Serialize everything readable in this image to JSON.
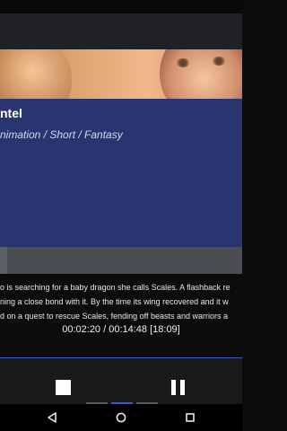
{
  "movie": {
    "title": "ntel",
    "genres": "nimation / Short / Fantasy",
    "description_lines": [
      "o is searching for a baby dragon she calls Scales. A flashback re",
      "ning a close bond with it. By the time its wing recovered and it w",
      "d on a quest to rescue Scales, fending off beasts and warriors a"
    ]
  },
  "player": {
    "time_readout": "00:02:20 / 00:14:48 [18:09]",
    "stop_icon": "stop-icon",
    "pause_icon": "pause-icon",
    "pages": 3,
    "active_page": 2
  },
  "navigation": {
    "back_icon": "back-triangle-icon",
    "home_icon": "home-circle-icon",
    "recents_icon": "recents-square-icon"
  },
  "colors": {
    "info_panel": "#2a3470",
    "accent": "#3b5bc2"
  }
}
